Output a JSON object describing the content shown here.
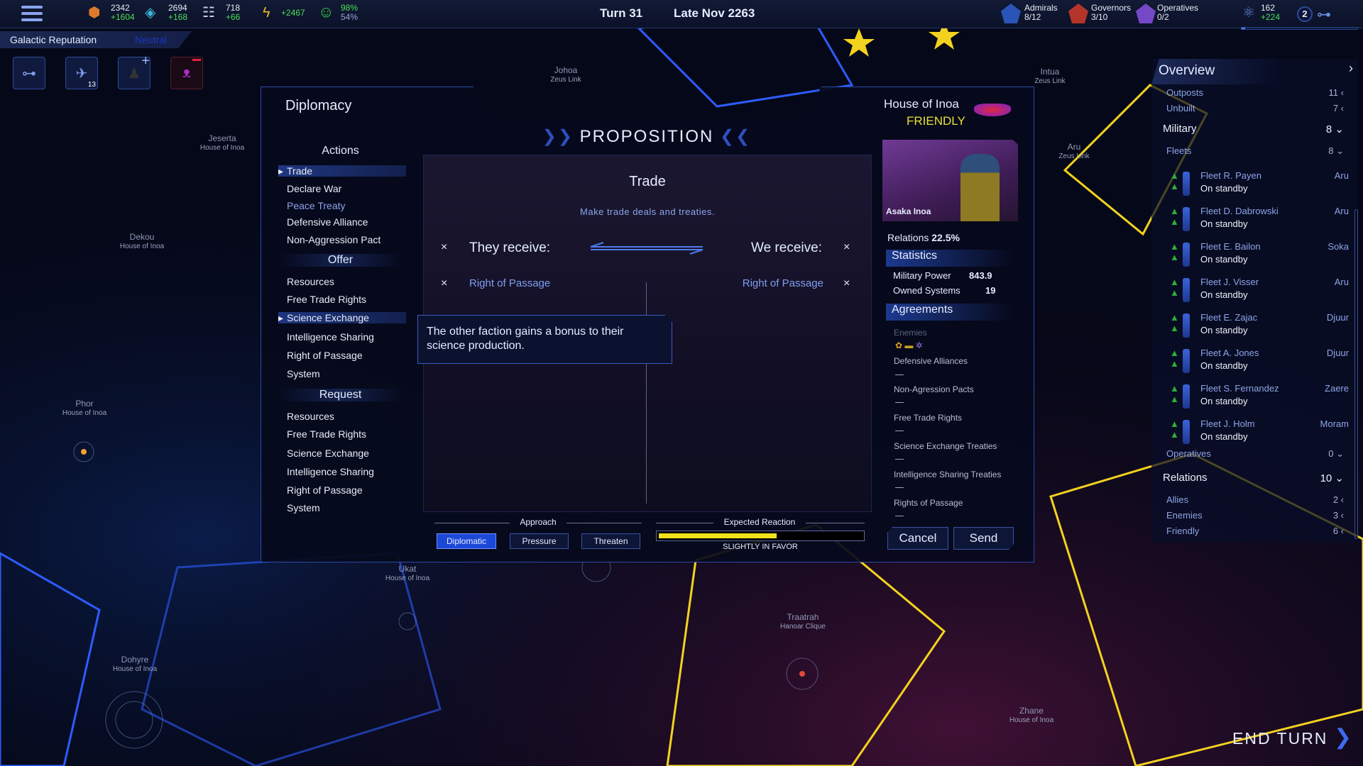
{
  "topbar": {
    "resources": [
      {
        "icon": "minerals-icon",
        "value": "2342",
        "delta": "+1604",
        "color": "#e07a2e"
      },
      {
        "icon": "crystal-icon",
        "value": "2694",
        "delta": "+168",
        "color": "#3fb7d8"
      },
      {
        "icon": "population-icon",
        "value": "718",
        "delta": "+66",
        "color": "#c9cede"
      },
      {
        "icon": "energy-icon",
        "value": "+2467",
        "color": "#e9b82a"
      },
      {
        "icon": "approval-icon",
        "value": "98%",
        "delta": "54%",
        "color": "#35d048"
      }
    ],
    "turn": "Turn 31",
    "date": "Late Nov 2263",
    "leaders": [
      {
        "label": "Admirals",
        "value": "8/12",
        "color": "#2b54b8"
      },
      {
        "label": "Governors",
        "value": "3/10",
        "color": "#b5342a"
      },
      {
        "label": "Operatives",
        "value": "0/2",
        "color": "#7548c8"
      }
    ],
    "research": {
      "value": "162",
      "delta": "+224",
      "progress": 0.03
    },
    "tech_badge": "2"
  },
  "reputation": {
    "label": "Galactic Reputation",
    "value": "Neutral"
  },
  "quick_icons": [
    {
      "icon": "tech-tree-icon"
    },
    {
      "icon": "fleet-icon",
      "badge": "13"
    },
    {
      "icon": "add-leader-icon"
    },
    {
      "icon": "faction-emblem-icon"
    }
  ],
  "map_labels": [
    {
      "name": "Johoa",
      "sub": "Zeus Link"
    },
    {
      "name": "Jeserta",
      "sub": "House of Inoa"
    },
    {
      "name": "Dekou",
      "sub": "House of Inoa"
    },
    {
      "name": "Phor",
      "sub": "House of Inoa"
    },
    {
      "name": "Dohyre",
      "sub": "House of Inoa"
    },
    {
      "name": "Ukat",
      "sub": "House of Inoa"
    },
    {
      "name": "Traatrah",
      "sub": "Hanoar Clique"
    },
    {
      "name": "Zhane",
      "sub": "House of Inoa"
    },
    {
      "name": "Intua",
      "sub": "Zeus Link"
    },
    {
      "name": "Aru",
      "sub": "Zeus Link"
    }
  ],
  "diplomacy": {
    "title": "Diplomacy",
    "heading": "PROPOSITION",
    "actions_header": "Actions",
    "actions": [
      "Trade",
      "Declare War",
      "Peace Treaty",
      "Defensive Alliance",
      "Non-Aggression Pact"
    ],
    "offer_header": "Offer",
    "offer": [
      "Resources",
      "Free Trade Rights",
      "Science Exchange",
      "Intelligence Sharing",
      "Right of Passage",
      "System"
    ],
    "request_header": "Request",
    "request": [
      "Resources",
      "Free Trade Rights",
      "Science Exchange",
      "Intelligence Sharing",
      "Right of Passage",
      "System"
    ],
    "trade_title": "Trade",
    "trade_subtitle": "Make trade deals and treaties.",
    "they_receive": "They receive:",
    "we_receive": "We receive:",
    "they_items": [
      "Right of Passage"
    ],
    "we_items": [
      "Right of Passage"
    ],
    "remove_glyph": "×",
    "tooltip": "The other faction gains a bonus to their science production.",
    "approach_label": "Approach",
    "approaches": [
      "Diplomatic",
      "Pressure",
      "Threaten"
    ],
    "selected_approach": "Diplomatic",
    "reaction_label": "Expected Reaction",
    "reaction_value": 0.58,
    "reaction_text": "SLIGHTLY IN FAVOR",
    "reaction_color": "#f2e21a",
    "cancel": "Cancel",
    "send": "Send"
  },
  "faction": {
    "name": "House of Inoa",
    "status": "FRIENDLY",
    "status_color": "#e6e13a",
    "leader": "Asaka Inoa",
    "relations_label": "Relations",
    "relations_value": "22.5%",
    "statistics_header": "Statistics",
    "military_power_label": "Military Power",
    "military_power": "843.9",
    "owned_systems_label": "Owned Systems",
    "owned_systems": "19",
    "agreements_header": "Agreements",
    "enemies_label": "Enemies",
    "agreements": [
      "Defensive Alliances",
      "Non-Agression Pacts",
      "Free Trade Rights",
      "Science Exchange Treaties",
      "Intelligence Sharing Treaties",
      "Rights of Passage"
    ]
  },
  "overview": {
    "title": "Overview",
    "rows_top": [
      {
        "label": "Outposts",
        "value": "11"
      },
      {
        "label": "Unbuilt",
        "value": "7"
      }
    ],
    "military": {
      "label": "Military",
      "value": "8"
    },
    "fleets": {
      "label": "Fleets",
      "value": "8"
    },
    "fleet_list": [
      {
        "name": "Fleet R. Payen",
        "status": "On standby",
        "location": "Aru"
      },
      {
        "name": "Fleet D. Dabrowski",
        "status": "On standby",
        "location": "Aru"
      },
      {
        "name": "Fleet E. Bailon",
        "status": "On standby",
        "location": "Soka"
      },
      {
        "name": "Fleet J. Visser",
        "status": "On standby",
        "location": "Aru"
      },
      {
        "name": "Fleet E. Zajac",
        "status": "On standby",
        "location": "Djuur"
      },
      {
        "name": "Fleet A. Jones",
        "status": "On standby",
        "location": "Djuur"
      },
      {
        "name": "Fleet S. Fernandez",
        "status": "On standby",
        "location": "Zaere"
      },
      {
        "name": "Fleet J. Holm",
        "status": "On standby",
        "location": "Moram"
      }
    ],
    "operatives": {
      "label": "Operatives",
      "value": "0"
    },
    "relations": {
      "label": "Relations",
      "value": "10"
    },
    "relation_rows": [
      {
        "label": "Allies",
        "value": "2"
      },
      {
        "label": "Enemies",
        "value": "3"
      },
      {
        "label": "Friendly",
        "value": "6"
      }
    ]
  },
  "end_turn": "END TURN"
}
